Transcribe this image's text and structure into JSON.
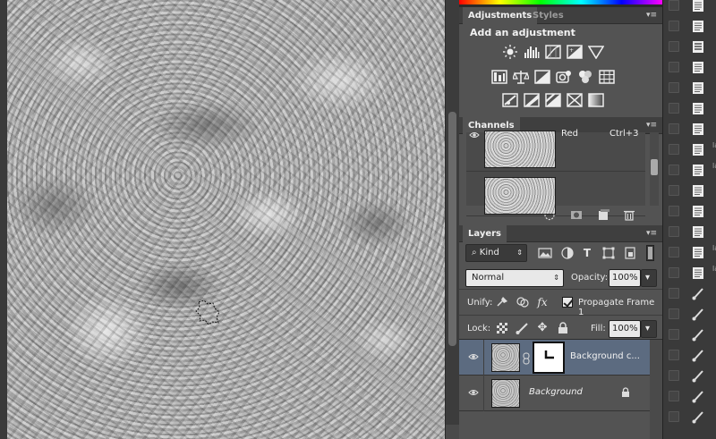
{
  "canvas": {
    "description_alt": ""
  },
  "adjustments": {
    "tabs": [
      {
        "label": "Adjustments",
        "active": true
      },
      {
        "label": "Styles",
        "active": false
      }
    ],
    "heading": "Add an adjustment",
    "row1_icons": [
      "brightness-contrast-icon",
      "levels-icon",
      "curves-icon",
      "exposure-icon",
      "vibrance-icon"
    ],
    "row2_icons": [
      "hue-saturation-icon",
      "color-balance-icon",
      "black-white-icon",
      "photo-filter-icon",
      "channel-mixer-icon",
      "color-lookup-icon"
    ],
    "row3_icons": [
      "invert-icon",
      "posterize-icon",
      "threshold-icon",
      "selective-color-icon",
      "gradient-map-icon"
    ]
  },
  "channels": {
    "tab_label": "Channels",
    "rows": [
      {
        "name": "Red",
        "shortcut": "Ctrl+3"
      },
      {
        "name": "",
        "shortcut": ""
      }
    ],
    "footer_icons": [
      "load-selection-icon",
      "save-selection-icon",
      "new-channel-icon",
      "delete-channel-icon"
    ]
  },
  "layers": {
    "tab_label": "Layers",
    "filter": {
      "label": "Kind",
      "icons": [
        "pixel-filter-icon",
        "adjustment-filter-icon",
        "type-filter-icon",
        "shape-filter-icon",
        "smart-object-filter-icon"
      ]
    },
    "blend_mode": "Normal",
    "opacity_label": "Opacity:",
    "opacity_value": "100%",
    "unify_label": "Unify:",
    "propagate_label": "Propagate Frame 1",
    "propagate_checked": true,
    "lock_label": "Lock:",
    "fill_label": "Fill:",
    "fill_value": "100%",
    "rows": [
      {
        "name": "Background c...",
        "selected": true,
        "has_mask": true,
        "locked": false
      },
      {
        "name": "Background",
        "selected": false,
        "has_mask": false,
        "locked": true
      }
    ]
  },
  "dock": {
    "tiny_labels": [
      "la",
      "la",
      "la",
      "la"
    ]
  },
  "colors": {
    "panel_bg": "#535353",
    "selected_layer": "#5c6b80",
    "tab_bar": "#3f3f3f"
  }
}
